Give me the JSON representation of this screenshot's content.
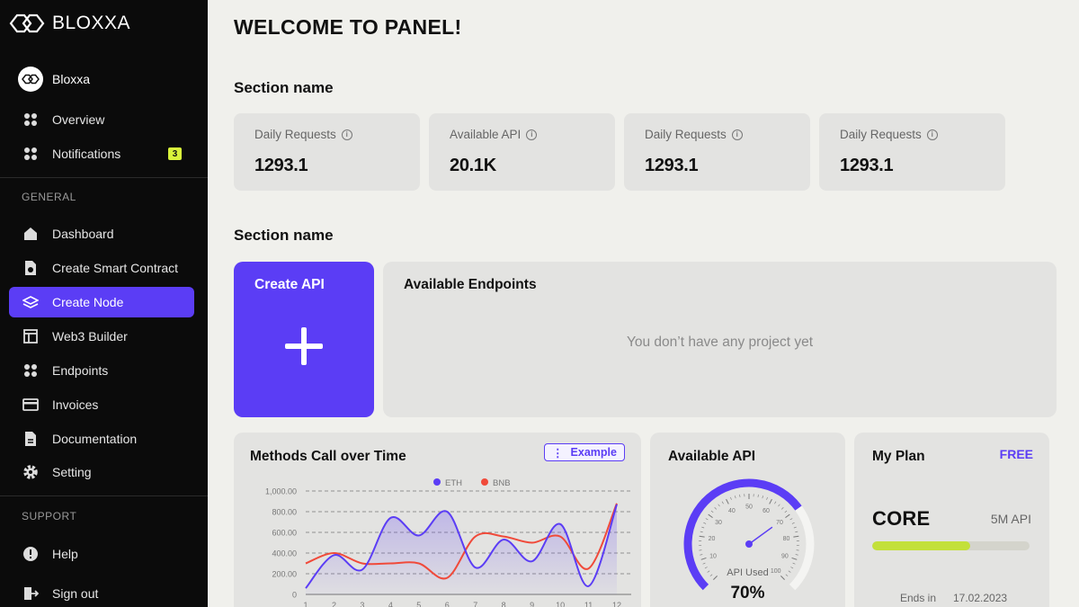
{
  "sidebar": {
    "brand": "BLOXXA",
    "profile_name": "Bloxxa",
    "top_items": [
      {
        "label": "Overview",
        "icon": "grid-icon"
      },
      {
        "label": "Notifications",
        "icon": "grid-icon",
        "badge": "3"
      }
    ],
    "general_heading": "GENERAL",
    "general_items": [
      {
        "label": "Dashboard",
        "icon": "home-icon"
      },
      {
        "label": "Create Smart Contract",
        "icon": "contract-file-icon"
      },
      {
        "label": "Create Node",
        "icon": "layers-icon",
        "active": true
      },
      {
        "label": "Web3 Builder",
        "icon": "layout-icon"
      },
      {
        "label": "Endpoints",
        "icon": "grid-icon"
      },
      {
        "label": "Invoices",
        "icon": "card-icon"
      },
      {
        "label": "Documentation",
        "icon": "document-icon"
      },
      {
        "label": "Setting",
        "icon": "gear-icon"
      }
    ],
    "support_heading": "SUPPORT",
    "support_items": [
      {
        "label": "Help",
        "icon": "alert-icon"
      },
      {
        "label": "Sign out",
        "icon": "signout-icon"
      }
    ]
  },
  "main": {
    "title": "WELCOME TO PANEL!",
    "section1_title": "Section name",
    "stats": [
      {
        "label": "Daily Requests",
        "value": "1293.1"
      },
      {
        "label": "Available API",
        "value": "20.1K"
      },
      {
        "label": "Daily Requests",
        "value": "1293.1"
      },
      {
        "label": "Daily Requests",
        "value": "1293.1"
      }
    ],
    "section2_title": "Section name",
    "create_api_label": "Create API",
    "endpoints_title": "Available Endpoints",
    "endpoints_empty": "You don’t have any project yet",
    "methods_panel": {
      "title": "Methods Call over Time",
      "example_label": "Example"
    },
    "api_panel": {
      "title": "Available API",
      "used_label": "API Used",
      "used_value": "70%",
      "used_fraction": 0.7
    },
    "plan_panel": {
      "title": "My Plan",
      "tier": "FREE",
      "plan_name": "CORE",
      "quota": "5M API",
      "usage_fraction": 0.62,
      "ends_label": "Ends in",
      "ends_date": "17.02.2023"
    }
  },
  "colors": {
    "accent": "#5b3df5",
    "eth": "#5b3df5",
    "bnb": "#f04a3a",
    "lime": "#c3e03a",
    "sidebar_bg": "#0b0b0b"
  },
  "chart_data": {
    "type": "line",
    "title": "Methods Call over Time",
    "x": [
      1,
      2,
      3,
      4,
      5,
      6,
      7,
      8,
      9,
      10,
      11,
      12
    ],
    "y_ticks": [
      "1,000.00",
      "800.00",
      "600.00",
      "400.00",
      "200.00",
      "0"
    ],
    "ylim": [
      0,
      1000
    ],
    "grid": true,
    "legend_position": "top",
    "series": [
      {
        "name": "ETH",
        "color": "#5b3df5",
        "values": [
          60,
          380,
          240,
          740,
          570,
          800,
          260,
          530,
          320,
          680,
          80,
          870
        ]
      },
      {
        "name": "BNB",
        "color": "#f04a3a",
        "values": [
          300,
          400,
          300,
          300,
          300,
          160,
          560,
          560,
          500,
          560,
          250,
          880
        ]
      }
    ],
    "gauge_ticks": [
      "10",
      "20",
      "30",
      "40",
      "50",
      "60",
      "70",
      "80",
      "90",
      "100"
    ]
  }
}
